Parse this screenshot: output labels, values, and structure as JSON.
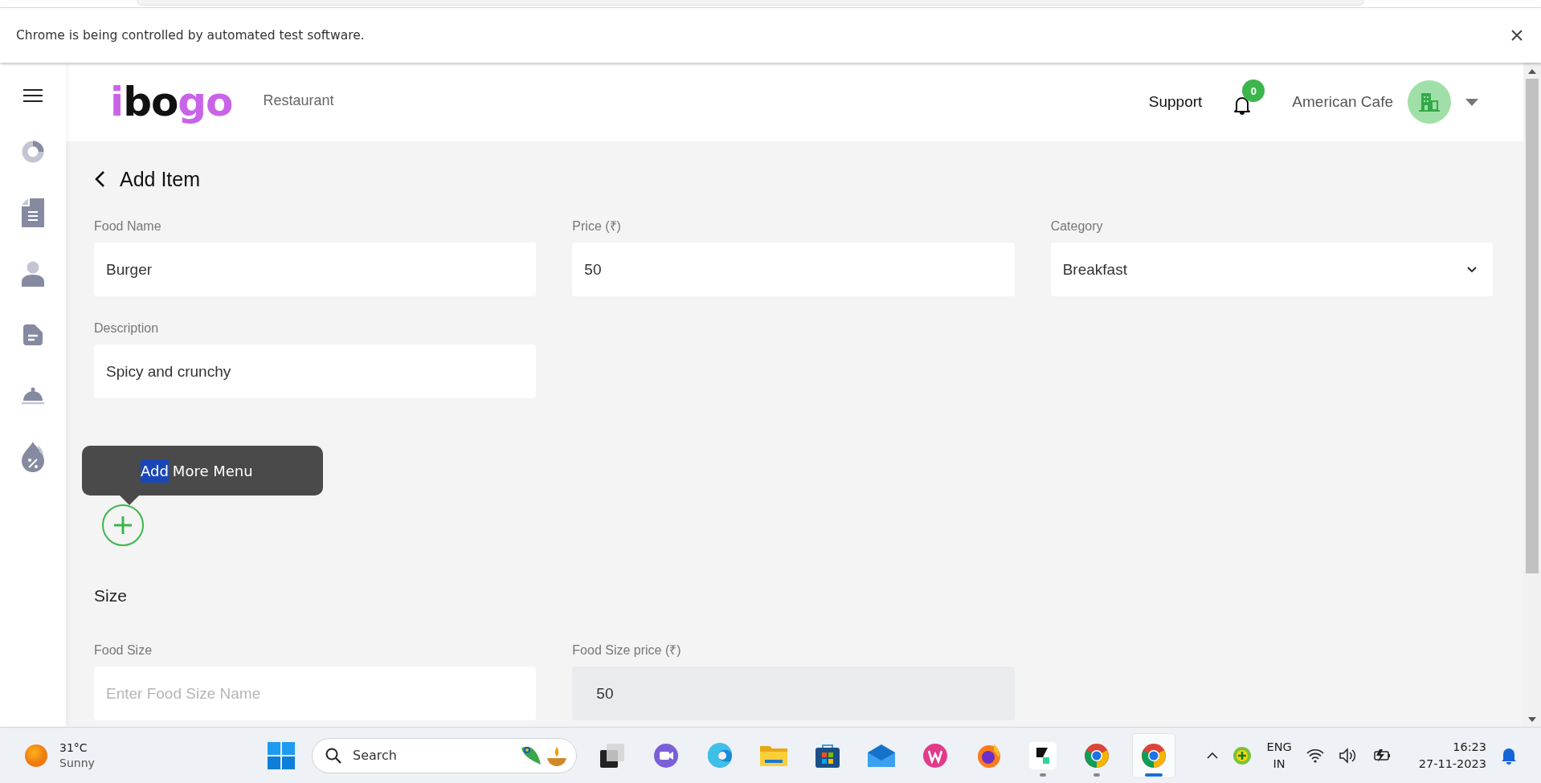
{
  "browser": {
    "infobar": {
      "message": "Chrome is being controlled by automated test software."
    }
  },
  "header": {
    "logo": [
      {
        "text": "i",
        "color": "#c963e8"
      },
      {
        "text": "bo",
        "color": "#111111"
      },
      {
        "text": "go",
        "color": "#c963e8"
      }
    ],
    "section": "Restaurant",
    "support": "Support",
    "notifications": "0",
    "account": "American Cafe"
  },
  "sidebar": {
    "items": [
      {
        "kind": "pie"
      },
      {
        "kind": "document"
      },
      {
        "kind": "user"
      },
      {
        "kind": "file"
      },
      {
        "kind": "cloche"
      },
      {
        "kind": "discount"
      }
    ]
  },
  "page": {
    "title": "Add Item",
    "fields": [
      {
        "label": "Food Name",
        "value": "Burger",
        "kind": "text"
      },
      {
        "label": "Price (₹)",
        "value": "50",
        "kind": "text"
      },
      {
        "label": "Category",
        "value": "Breakfast",
        "kind": "select"
      },
      {
        "label": "Description",
        "value": "Spicy and crunchy",
        "kind": "text"
      }
    ],
    "addon": {
      "tooltip": [
        {
          "text": "Add",
          "selected": true
        },
        {
          "text": "More Menu",
          "selected": false
        }
      ]
    },
    "size": {
      "heading": "Size",
      "fields": [
        {
          "label": "Food Size",
          "placeholder": "Enter Food Size Name",
          "kind": "text",
          "disabled": false
        },
        {
          "label": "Food Size price (₹)",
          "value": "50",
          "kind": "text",
          "disabled": true
        }
      ]
    }
  },
  "taskbar": {
    "weather": {
      "temp": "31°C",
      "condition": "Sunny"
    },
    "search": {
      "placeholder": "Search"
    },
    "apps": [
      {
        "kind": "taskview",
        "running": false,
        "selected": false
      },
      {
        "kind": "meet",
        "running": false,
        "selected": false
      },
      {
        "kind": "edge",
        "running": false,
        "selected": false
      },
      {
        "kind": "explorer",
        "running": false,
        "selected": false
      },
      {
        "kind": "store",
        "running": false,
        "selected": false
      },
      {
        "kind": "mail",
        "running": false,
        "selected": false
      },
      {
        "kind": "wps",
        "running": false,
        "selected": false
      },
      {
        "kind": "firefox",
        "running": false,
        "selected": false
      },
      {
        "kind": "app",
        "running": true,
        "selected": false
      },
      {
        "kind": "chrome",
        "running": true,
        "selected": false
      },
      {
        "kind": "chrome",
        "running": true,
        "selected": true
      }
    ],
    "tray": {
      "language": "ENG",
      "region": "IN",
      "time": "16:23",
      "date": "27-11-2023"
    }
  }
}
